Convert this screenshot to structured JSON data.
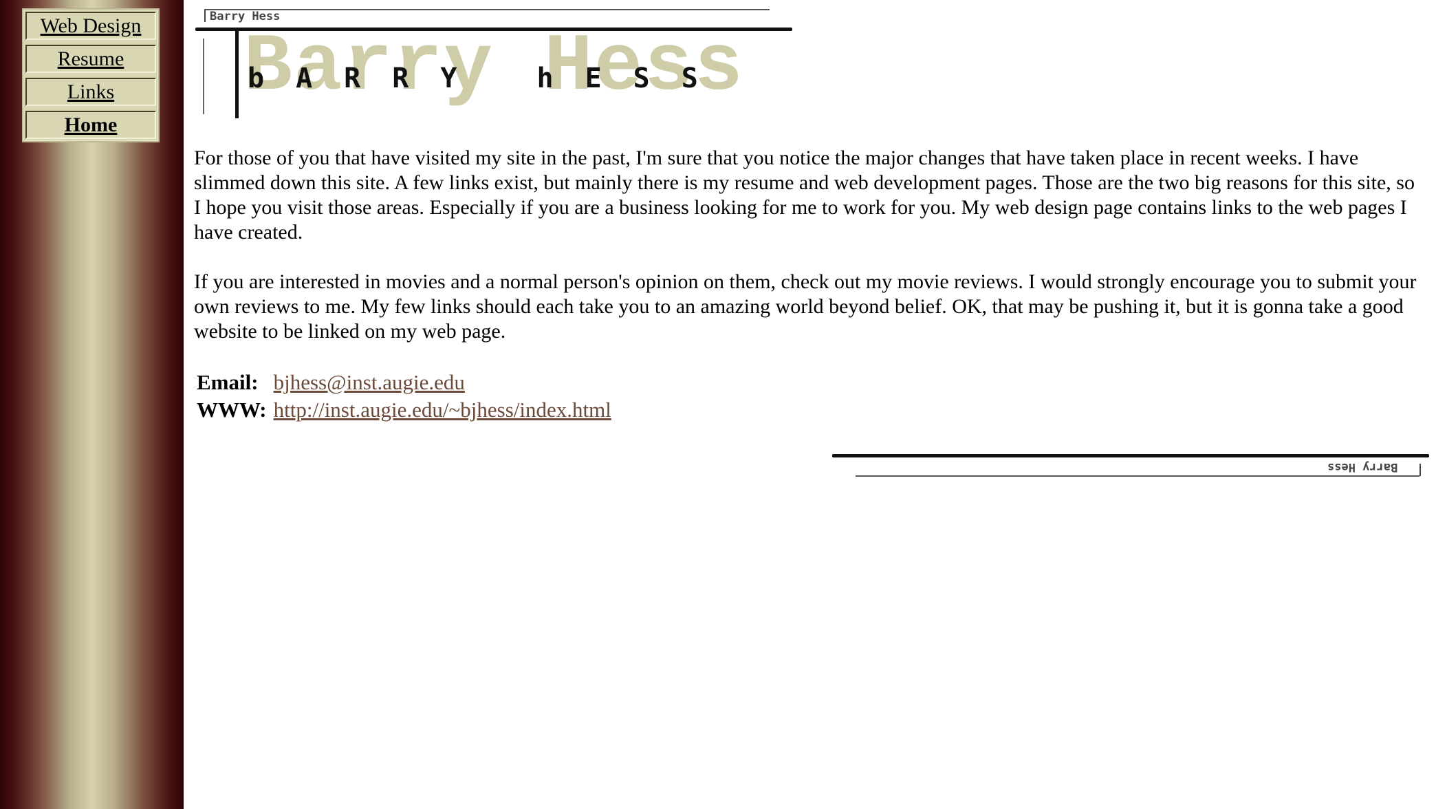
{
  "sidebar": {
    "nav": [
      {
        "label": "Web Design"
      },
      {
        "label": "Resume"
      },
      {
        "label": "Links"
      },
      {
        "label": "Home"
      }
    ]
  },
  "banner": {
    "small_name": "Barry Hess",
    "big_text": "Barry Hess",
    "spaced_text": "bARRY hESS"
  },
  "content": {
    "paragraphs": [
      "For those of you that have visited my site in the past, I'm sure that you notice the major changes that have taken place in recent weeks. I have slimmed down this site. A few links exist, but mainly there is my resume and web development pages. Those are the two big reasons for this site, so I hope you visit those areas. Especially if you are a business looking for me to work for you. My web design page contains links to the web pages I have created.",
      "If you are interested in movies and a normal person's opinion on them, check out my movie reviews. I would strongly encourage you to submit your own reviews to me. My few links should each take you to an amazing world beyond belief. OK, that may be pushing it, but it is gonna take a good website to be linked on my web page."
    ],
    "contact": {
      "email_label": "Email:",
      "email_value": "bjhess@inst.augie.edu",
      "www_label": "WWW:",
      "www_value": "http://inst.augie.edu/~bjhess/index.html"
    }
  },
  "footer_banner": {
    "small_name": "Barry Hess"
  },
  "colors": {
    "sidebar_dark": "#2e0606",
    "sidebar_light": "#d6d1ac",
    "nav_bg": "#d9d6b3",
    "link_color": "#6b4a3a",
    "ghost_text": "#cfcca8"
  }
}
